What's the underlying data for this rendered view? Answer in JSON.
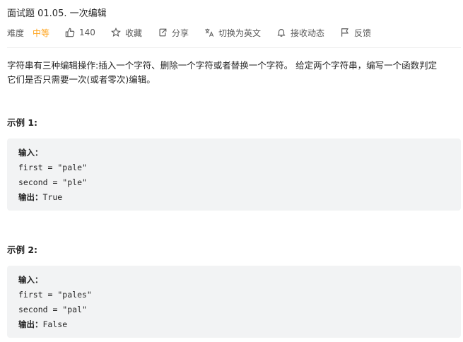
{
  "problem": {
    "title": "面试题 01.05. 一次编辑",
    "difficulty_label": "难度",
    "difficulty_value": "中等",
    "difficulty_color": "#ffa116"
  },
  "actions": {
    "likes": "140",
    "collect": "收藏",
    "share": "分享",
    "translate": "切换为英文",
    "notify": "接收动态",
    "feedback": "反馈"
  },
  "description": {
    "line1": "字符串有三种编辑操作:插入一个字符、删除一个字符或者替换一个字符。 给定两个字符串，编写一个函数判定",
    "line2": "它们是否只需要一次(或者零次)编辑。"
  },
  "examples": [
    {
      "title": "示例 1:",
      "input_label": "输入：",
      "lines": [
        "first = \"pale\"",
        "second = \"ple\""
      ],
      "output_label": "输出：",
      "output_value": "True"
    },
    {
      "title": "示例 2:",
      "input_label": "输入：",
      "lines": [
        "first = \"pales\"",
        "second = \"pal\""
      ],
      "output_label": "输出：",
      "output_value": "False"
    }
  ]
}
